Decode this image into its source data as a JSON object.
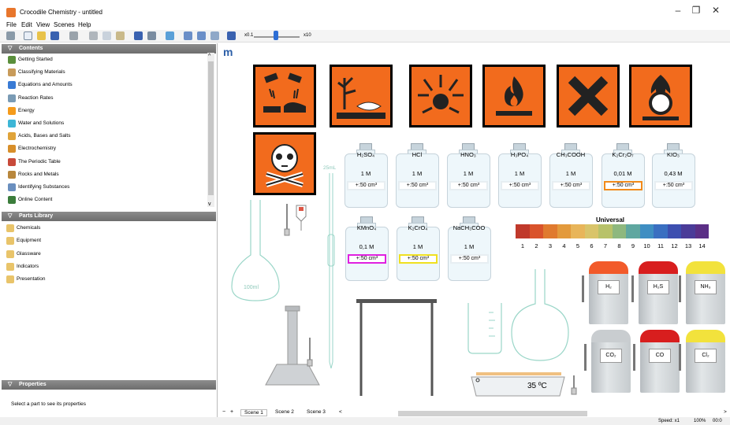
{
  "window": {
    "title": "Crocodile Chemistry - untitled",
    "minimize": "–",
    "restore": "❐",
    "close": "✕"
  },
  "menu": [
    "File",
    "Edit",
    "View",
    "Scenes",
    "Help"
  ],
  "toolbar": {
    "zoom_min": "x0.1",
    "zoom_max": "x10",
    "zoom_level": 0.5
  },
  "contents": {
    "header": "Contents",
    "items": [
      {
        "label": "Getting Started",
        "icon": "crocodile-icon",
        "color": "#5a8f3b"
      },
      {
        "label": "Classifying Materials",
        "icon": "materials-icon",
        "color": "#c89b5a"
      },
      {
        "label": "Equations and Amounts",
        "icon": "equation-icon",
        "color": "#3a7bd5"
      },
      {
        "label": "Reaction Rates",
        "icon": "graph-icon",
        "color": "#7a9bb5"
      },
      {
        "label": "Energy",
        "icon": "flame-icon",
        "color": "#f59b1b"
      },
      {
        "label": "Water and Solutions",
        "icon": "drop-icon",
        "color": "#3db6d6"
      },
      {
        "label": "Acids, Bases and Salts",
        "icon": "bottle-icon",
        "color": "#e0a43a"
      },
      {
        "label": "Electrochemistry",
        "icon": "battery-icon",
        "color": "#d88f2a"
      },
      {
        "label": "The Periodic Table",
        "icon": "table-icon",
        "color": "#c84a3a"
      },
      {
        "label": "Rocks and Metals",
        "icon": "rocks-icon",
        "color": "#b8873d"
      },
      {
        "label": "Identifying Substances",
        "icon": "magnifier-icon",
        "color": "#6a8fbf"
      },
      {
        "label": "Online Content",
        "icon": "globe-icon",
        "color": "#3b7d3b"
      }
    ]
  },
  "parts": {
    "header": "Parts Library",
    "items": [
      {
        "label": "Chemicals",
        "icon": "folder-icon",
        "color": "#e9c46a"
      },
      {
        "label": "Equipment",
        "icon": "folder-icon",
        "color": "#e9c46a"
      },
      {
        "label": "Glassware",
        "icon": "folder-icon",
        "color": "#e9c46a"
      },
      {
        "label": "Indicators",
        "icon": "folder-icon",
        "color": "#e9c46a"
      },
      {
        "label": "Presentation",
        "icon": "folder-icon",
        "color": "#e9c46a"
      }
    ]
  },
  "properties": {
    "header": "Properties",
    "text": "Select a part to see its properties"
  },
  "canvas": {
    "logo": "m",
    "hazards": [
      "corrosive-icon",
      "environmental-hazard-icon",
      "explosive-icon",
      "flammable-icon",
      "harmful-icon",
      "oxidizing-icon",
      "toxic-icon"
    ],
    "bottles": [
      {
        "formula": "H₂SO₄",
        "conc": "1 M",
        "vol": "+:50 cm³",
        "border": "#e7eef2"
      },
      {
        "formula": "HCl",
        "conc": "1 M",
        "vol": "+:50 cm³",
        "border": "#e7eef2"
      },
      {
        "formula": "HNO₃",
        "conc": "1 M",
        "vol": "+:50 cm³",
        "border": "#e7eef2"
      },
      {
        "formula": "H₃PO₄",
        "conc": "1 M",
        "vol": "+:50 cm³",
        "border": "#e7eef2"
      },
      {
        "formula": "CH₃COOH",
        "conc": "1 M",
        "vol": "+:50 cm³",
        "border": "#e7eef2"
      },
      {
        "formula": "K₂Cr₂O₇",
        "conc": "0,01 M",
        "vol": "+:50 cm³",
        "border": "#f28a1a"
      },
      {
        "formula": "KIO₃",
        "conc": "0,43 M",
        "vol": "+:50 cm³",
        "border": "#e7eef2"
      },
      {
        "formula": "KMnO₄",
        "conc": "0,1 M",
        "vol": "+:50 cm³",
        "border": "#e020e0"
      },
      {
        "formula": "K₂CrO₄",
        "conc": "1 M",
        "vol": "+:50 cm³",
        "border": "#f0e020"
      },
      {
        "formula": "NaCH₃COO",
        "conc": "1 M",
        "vol": "+:50 cm³",
        "border": "#e7eef2"
      }
    ],
    "flask_label": "100ml",
    "burette_label": "25mL",
    "indicator": {
      "title": "Universal",
      "ticks": [
        "1",
        "2",
        "3",
        "4",
        "5",
        "6",
        "7",
        "8",
        "9",
        "10",
        "11",
        "12",
        "13",
        "14"
      ],
      "colors": [
        "#c0392b",
        "#d9532b",
        "#e07a2e",
        "#e39a3c",
        "#e8b55a",
        "#d9c46a",
        "#b8c26a",
        "#8eb87e",
        "#5fa7a0",
        "#3f8ec2",
        "#3a6fc1",
        "#3d4fb0",
        "#4a3b98",
        "#5b2f86"
      ]
    },
    "gases": [
      {
        "label": "H₂",
        "cap": "#f25a2a"
      },
      {
        "label": "H₂S",
        "cap": "#d81e1e"
      },
      {
        "label": "NH₃",
        "cap": "#f2e23c"
      },
      {
        "label": "CO₂",
        "cap": "#c9cdd0"
      },
      {
        "label": "CO",
        "cap": "#d81e1e"
      },
      {
        "label": "Cl₂",
        "cap": "#f2e23c"
      }
    ],
    "hotplate_temp": "35 ºC"
  },
  "scenes": {
    "add": "−",
    "plus": "+",
    "tabs": [
      "Scene 1",
      "Scene 2",
      "Scene 3"
    ],
    "prev": "<",
    "next": ">"
  },
  "status": {
    "speed": "Speed: x1",
    "zoom": "100%",
    "time": "00:0"
  }
}
